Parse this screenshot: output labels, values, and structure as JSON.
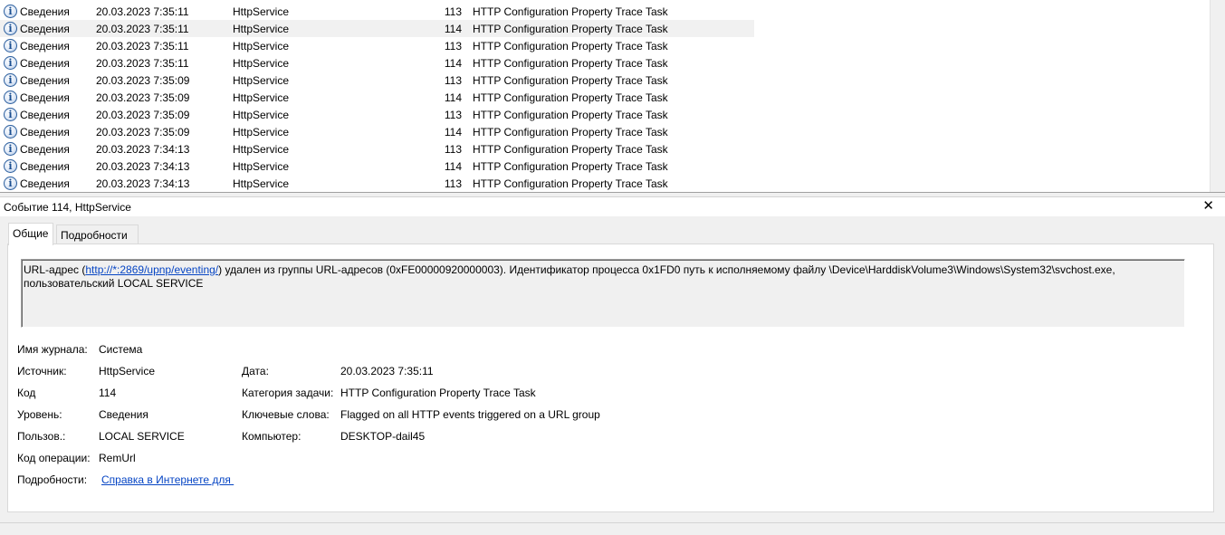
{
  "event_list": {
    "rows": [
      {
        "level": "Сведения",
        "date": "20.03.2023 7:35:11",
        "source": "HttpService",
        "event_id": "113",
        "task": "HTTP Configuration Property Trace Task",
        "selected": false
      },
      {
        "level": "Сведения",
        "date": "20.03.2023 7:35:11",
        "source": "HttpService",
        "event_id": "114",
        "task": "HTTP Configuration Property Trace Task",
        "selected": true
      },
      {
        "level": "Сведения",
        "date": "20.03.2023 7:35:11",
        "source": "HttpService",
        "event_id": "113",
        "task": "HTTP Configuration Property Trace Task",
        "selected": false
      },
      {
        "level": "Сведения",
        "date": "20.03.2023 7:35:11",
        "source": "HttpService",
        "event_id": "114",
        "task": "HTTP Configuration Property Trace Task",
        "selected": false
      },
      {
        "level": "Сведения",
        "date": "20.03.2023 7:35:09",
        "source": "HttpService",
        "event_id": "113",
        "task": "HTTP Configuration Property Trace Task",
        "selected": false
      },
      {
        "level": "Сведения",
        "date": "20.03.2023 7:35:09",
        "source": "HttpService",
        "event_id": "114",
        "task": "HTTP Configuration Property Trace Task",
        "selected": false
      },
      {
        "level": "Сведения",
        "date": "20.03.2023 7:35:09",
        "source": "HttpService",
        "event_id": "113",
        "task": "HTTP Configuration Property Trace Task",
        "selected": false
      },
      {
        "level": "Сведения",
        "date": "20.03.2023 7:35:09",
        "source": "HttpService",
        "event_id": "114",
        "task": "HTTP Configuration Property Trace Task",
        "selected": false
      },
      {
        "level": "Сведения",
        "date": "20.03.2023 7:34:13",
        "source": "HttpService",
        "event_id": "113",
        "task": "HTTP Configuration Property Trace Task",
        "selected": false
      },
      {
        "level": "Сведения",
        "date": "20.03.2023 7:34:13",
        "source": "HttpService",
        "event_id": "114",
        "task": "HTTP Configuration Property Trace Task",
        "selected": false
      },
      {
        "level": "Сведения",
        "date": "20.03.2023 7:34:13",
        "source": "HttpService",
        "event_id": "113",
        "task": "HTTP Configuration Property Trace Task",
        "selected": false
      }
    ],
    "level_icon": "info-icon"
  },
  "detail": {
    "title": "Событие 114, HttpService",
    "close_icon": "close-icon",
    "tabs": [
      {
        "label": "Общие",
        "active": true
      },
      {
        "label": "Подробности",
        "active": false
      }
    ],
    "message": {
      "prefix": "URL-адрес (",
      "link": "http://*:2869/upnp/eventing/",
      "suffix": ") удален из группы URL-адресов (0xFE00000920000003). Идентификатор процесса 0x1FD0 путь к исполняемому файлу \\Device\\HarddiskVolume3\\Windows\\System32\\svchost.exe,",
      "line2": "пользовательский LOCAL SERVICE"
    },
    "fields": {
      "log_name_label": "Имя журнала:",
      "log_name": "Система",
      "source_label": "Источник:",
      "source": "HttpService",
      "date_label": "Дата:",
      "date": "20.03.2023 7:35:11",
      "code_label": "Код",
      "code": "114",
      "task_category_label": "Категория задачи:",
      "task_category": "HTTP Configuration Property Trace Task",
      "level_label": "Уровень:",
      "level": "Сведения",
      "keywords_label": "Ключевые слова:",
      "keywords": "Flagged on all HTTP events triggered on a URL group",
      "user_label": "Пользов.:",
      "user": "LOCAL SERVICE",
      "computer_label": "Компьютер:",
      "computer": "DESKTOP-dail45",
      "opcode_label": "Код операции:",
      "opcode": "RemUrl",
      "more_info_label": "Подробности:",
      "more_info_link": "Справка в Интернете для "
    }
  },
  "colors": {
    "selected_row": "#f1f1f1",
    "link": "#0645c4",
    "background": "#f0f0f0"
  }
}
